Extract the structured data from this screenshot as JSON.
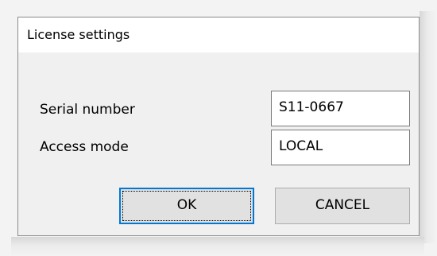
{
  "dialog": {
    "title": "License settings",
    "fields": [
      {
        "label": "Serial number",
        "value": "S11-0667"
      },
      {
        "label": "Access mode",
        "value": "LOCAL"
      }
    ],
    "buttons": {
      "ok_label": "OK",
      "cancel_label": "CANCEL"
    }
  }
}
